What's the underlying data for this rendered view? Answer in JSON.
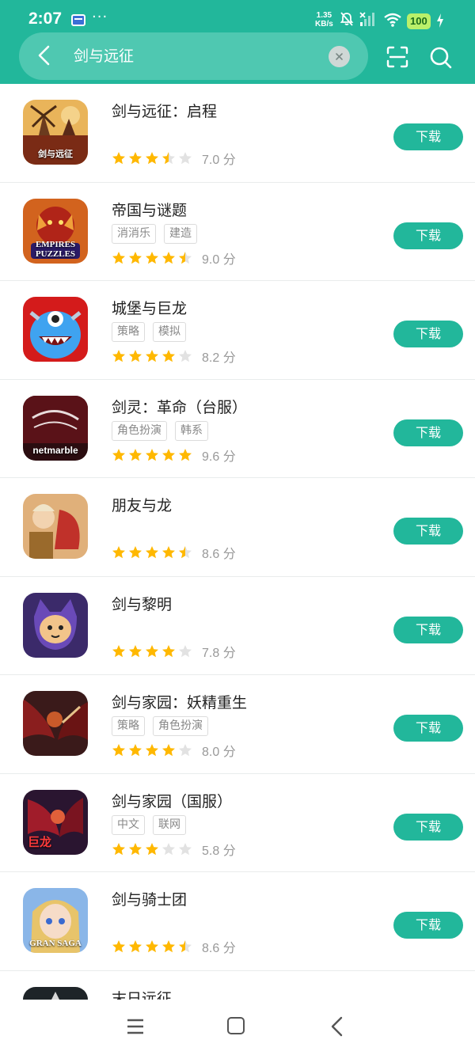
{
  "status_bar": {
    "time": "2:07",
    "speed_value": "1.35",
    "speed_unit": "KB/s",
    "battery": "100",
    "more_dots": "···"
  },
  "search": {
    "query": "剑与远征",
    "clear_icon": "close-icon"
  },
  "colors": {
    "primary": "#22b79b",
    "star_filled": "#ffb800",
    "star_empty": "#e2e2e2"
  },
  "apps": [
    {
      "name": "剑与远征：启程",
      "tags": [],
      "stars": 3.5,
      "score": "7.0 分",
      "button": "下载",
      "icon_text": "剑与远征"
    },
    {
      "name": "帝国与谜题",
      "tags": [
        "消消乐",
        "建造"
      ],
      "stars": 4.5,
      "score": "9.0 分",
      "button": "下载",
      "icon_text": "EMPIRES PUZZLES"
    },
    {
      "name": "城堡与巨龙",
      "tags": [
        "策略",
        "模拟"
      ],
      "stars": 4,
      "score": "8.2 分",
      "button": "下载",
      "icon_text": ""
    },
    {
      "name": "剑灵：革命（台服）",
      "tags": [
        "角色扮演",
        "韩系"
      ],
      "stars": 5,
      "score": "9.6 分",
      "button": "下载",
      "icon_text": "netmarble"
    },
    {
      "name": "朋友与龙",
      "tags": [],
      "stars": 4.5,
      "score": "8.6 分",
      "button": "下载",
      "icon_text": ""
    },
    {
      "name": "剑与黎明",
      "tags": [],
      "stars": 4,
      "score": "7.8 分",
      "button": "下载",
      "icon_text": ""
    },
    {
      "name": "剑与家园：妖精重生",
      "tags": [
        "策略",
        "角色扮演"
      ],
      "stars": 4,
      "score": "8.0 分",
      "button": "下载",
      "icon_text": ""
    },
    {
      "name": "剑与家园（国服）",
      "tags": [
        "中文",
        "联网"
      ],
      "stars": 3,
      "score": "5.8 分",
      "button": "下载",
      "icon_text": "巨龙"
    },
    {
      "name": "剑与骑士团",
      "tags": [],
      "stars": 4.5,
      "score": "8.6 分",
      "button": "下载",
      "icon_text": "GRAN SAGA"
    },
    {
      "name": "末日远征",
      "tags": [],
      "stars": 0,
      "score": "",
      "button": "",
      "icon_text": ""
    }
  ]
}
